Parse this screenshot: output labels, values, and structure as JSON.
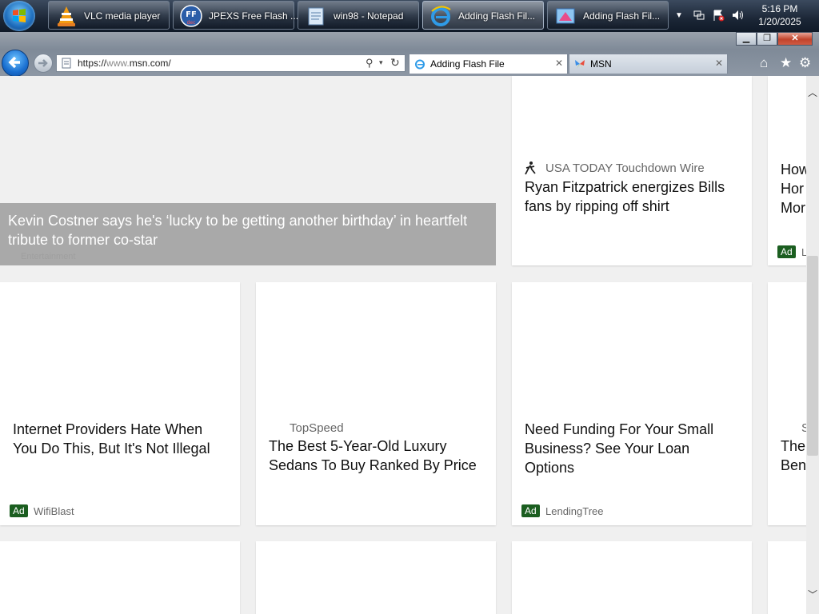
{
  "taskbar": {
    "buttons": [
      {
        "label": "VLC media player",
        "icon": "vlc-icon"
      },
      {
        "label": "JPEXS Free Flash ...",
        "icon": "ffdec-icon"
      },
      {
        "label": "win98 - Notepad",
        "icon": "notepad-icon"
      },
      {
        "label": "Adding Flash Fil...",
        "icon": "ie-icon"
      },
      {
        "label": "Adding Flash Fil...",
        "icon": "ie-paint-icon"
      }
    ],
    "clock": {
      "time": "5:16 PM",
      "date": "1/20/2025"
    }
  },
  "browser": {
    "url_prefix": "https://",
    "url_host": "www.",
    "url_domain": "msn.com/",
    "tabs": [
      {
        "label": "Adding Flash File",
        "icon": "ie-icon",
        "active": true
      },
      {
        "label": "MSN",
        "icon": "msn-butterfly-icon",
        "active": false
      }
    ],
    "window_buttons": [
      "minimize",
      "restore",
      "close"
    ]
  },
  "feed": {
    "featured": {
      "title": "Kevin Costner says he's ‘lucky to be getting another birthday’ in heartfelt tribute to former co-star",
      "source": "Entertainment"
    },
    "top_right": {
      "source": "USA TODAY Touchdown Wire",
      "title": "Ryan Fitzpatrick energizes Bills fans by ripping off shirt"
    },
    "edge_top": {
      "lines": [
        "How",
        "Hor",
        "Mor"
      ],
      "badge": "Ad",
      "advertiser": "L"
    },
    "row2": [
      {
        "title": "Internet Providers Hate When You Do This, But It's Not Illegal",
        "badge": "Ad",
        "advertiser": "WifiBlast"
      },
      {
        "source": "TopSpeed",
        "title": "The Best 5-Year-Old Luxury Sedans To Buy Ranked By Price"
      },
      {
        "title": "Need Funding For Your Small Business? See Your Loan Options",
        "badge": "Ad",
        "advertiser": "LendingTree"
      }
    ],
    "edge_row2": {
      "source": "S",
      "lines": [
        "The",
        "Ben"
      ]
    }
  },
  "colors": {
    "ad_badge": "#1b5e20",
    "overlay": "#a9a9a9",
    "accent_blue": "#1a6fd0"
  }
}
